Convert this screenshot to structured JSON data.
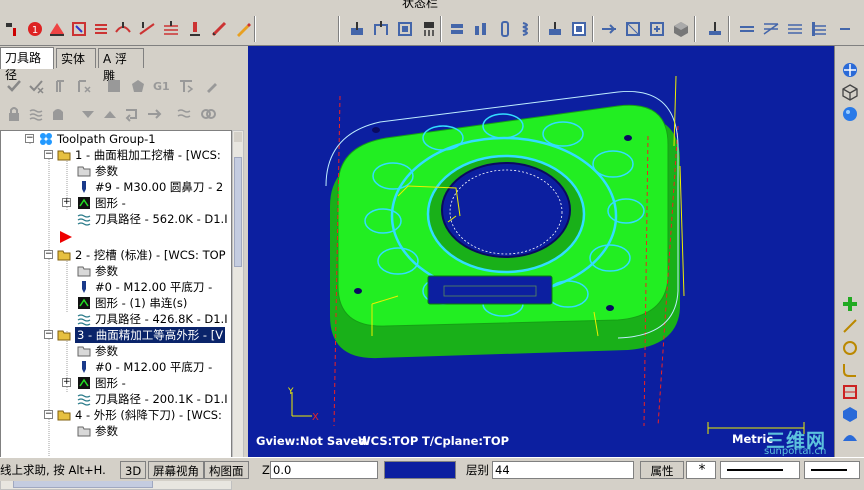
{
  "menu": {
    "title_fragment": "状态栏"
  },
  "panel": {
    "tabs": [
      {
        "label": "刀具路径"
      },
      {
        "label": "实体"
      },
      {
        "label": "A 浮雕"
      }
    ]
  },
  "tree": {
    "root": "Toolpath Group-1",
    "op1": {
      "label": "1 - 曲面粗加工挖槽 - [WCS:",
      "params": "参数",
      "tool": "#9 - M30.00 圆鼻刀 -   2",
      "geometry": "图形 -",
      "toolpath": "刀具路径 - 562.0K - D1.I"
    },
    "op2": {
      "label": "2 - 挖槽 (标准) - [WCS: TOP",
      "params": "参数",
      "tool": "#0 - M12.00 平底刀 -",
      "geometry": "图形 - (1) 串连(s)",
      "toolpath": "刀具路径 - 426.8K - D1.I"
    },
    "op3": {
      "label": "3 - 曲面精加工等高外形 - [V",
      "params": "参数",
      "tool": "#0 - M12.00 平底刀 -",
      "geometry": "图形 -",
      "toolpath": "刀具路径 - 200.1K - D1.I"
    },
    "op4": {
      "label": "4 - 外形 (斜降下刀) - [WCS:",
      "params": "参数"
    }
  },
  "viewport": {
    "gview": "Gview:Not Saved",
    "wcs": "WCS:TOP",
    "tcplane": "T/Cplane:TOP",
    "units": "Metric",
    "watermark_line1": "三维网",
    "watermark_line2": "sunportal.cn"
  },
  "status": {
    "help": "线上求助, 按 Alt+H.",
    "btn_3d": "3D",
    "btn_screen_view": "屏幕视角",
    "btn_plane": "构图面",
    "z_label": "Z",
    "z_value": "0.0",
    "level_label": "层别",
    "level_value": "44",
    "attributes": "属性",
    "point_style": "*"
  },
  "colors": {
    "viewport_bg": "#0c1fa0",
    "part_green": "#22ee22",
    "toolpath_cyan": "#33ddff",
    "selection": "#0a246a"
  }
}
